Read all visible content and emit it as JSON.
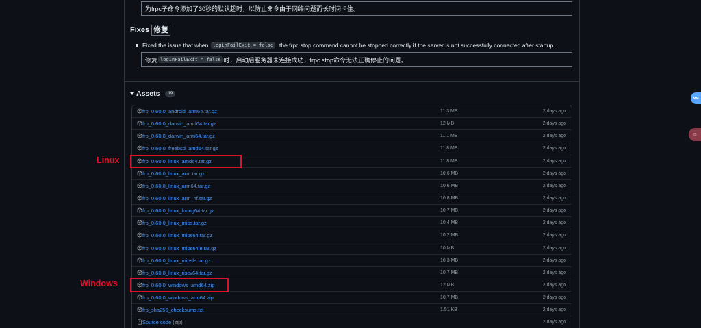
{
  "release": {
    "top_translation": "为frpc子命令添加了30秒的默认超时，以防止命令由于网络问题而长时间卡住。",
    "fixes_heading_en": "Fixes",
    "fixes_heading_cn": "修复",
    "fix_en_before": "Fixed the issue that when",
    "fix_code": "loginFailExit = false",
    "fix_en_after": ", the frpc stop command cannot be stopped correctly if the server is not successfully connected after startup.",
    "fix_cn_before": "修复",
    "fix_cn_code": "loginFailExit = false",
    "fix_cn_after": "时，启动后服务器未连接成功，frpc stop命令无法正确停止的问题。"
  },
  "assets": {
    "label": "Assets",
    "count": "19",
    "rows": [
      {
        "name": "frp_0.60.0_android_arm64.tar.gz",
        "size": "11.3 MB",
        "date": "2 days ago"
      },
      {
        "name": "frp_0.60.0_darwin_amd64.tar.gz",
        "size": "12 MB",
        "date": "2 days ago"
      },
      {
        "name": "frp_0.60.0_darwin_arm64.tar.gz",
        "size": "11.1 MB",
        "date": "2 days ago"
      },
      {
        "name": "frp_0.60.0_freebsd_amd64.tar.gz",
        "size": "11.8 MB",
        "date": "2 days ago"
      },
      {
        "name": "frp_0.60.0_linux_amd64.tar.gz",
        "size": "11.8 MB",
        "date": "2 days ago"
      },
      {
        "name": "frp_0.60.0_linux_arm.tar.gz",
        "size": "10.6 MB",
        "date": "2 days ago"
      },
      {
        "name": "frp_0.60.0_linux_arm64.tar.gz",
        "size": "10.6 MB",
        "date": "2 days ago"
      },
      {
        "name": "frp_0.60.0_linux_arm_hf.tar.gz",
        "size": "10.8 MB",
        "date": "2 days ago"
      },
      {
        "name": "frp_0.60.0_linux_loong64.tar.gz",
        "size": "10.7 MB",
        "date": "2 days ago"
      },
      {
        "name": "frp_0.60.0_linux_mips.tar.gz",
        "size": "10.4 MB",
        "date": "2 days ago"
      },
      {
        "name": "frp_0.60.0_linux_mips64.tar.gz",
        "size": "10.2 MB",
        "date": "2 days ago"
      },
      {
        "name": "frp_0.60.0_linux_mips64le.tar.gz",
        "size": "10 MB",
        "date": "2 days ago"
      },
      {
        "name": "frp_0.60.0_linux_mipsle.tar.gz",
        "size": "10.3 MB",
        "date": "2 days ago"
      },
      {
        "name": "frp_0.60.0_linux_riscv64.tar.gz",
        "size": "10.7 MB",
        "date": "2 days ago"
      },
      {
        "name": "frp_0.60.0_windows_amd64.zip",
        "size": "12 MB",
        "date": "2 days ago"
      },
      {
        "name": "frp_0.60.0_windows_arm64.zip",
        "size": "10.7 MB",
        "date": "2 days ago"
      },
      {
        "name": "frp_sha256_checksums.txt",
        "size": "1.51 KB",
        "date": "2 days ago"
      }
    ],
    "source": {
      "name": "Source code",
      "suffix": "(zip)",
      "date": "2 days ago"
    }
  },
  "annotations": {
    "linux": "Linux",
    "windows": "Windows",
    "color": "#e0102a"
  },
  "floating": {
    "avatar1_text": "MM"
  },
  "colors": {
    "background": "#0d1117",
    "link": "#4493f8",
    "muted": "#8d96a0",
    "border": "#30363d"
  },
  "icons": {
    "asset": "package-icon",
    "source": "file-zip-icon",
    "toggle": "triangle-down-icon"
  }
}
